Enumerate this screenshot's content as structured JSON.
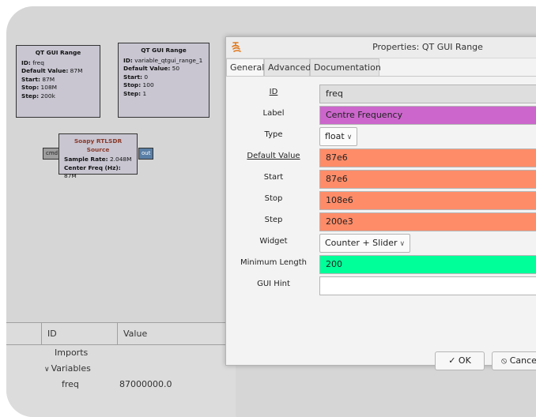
{
  "flowgraph": {
    "blocks": [
      {
        "title": "QT GUI Range",
        "lines": [
          {
            "key": "ID:",
            "value": " freq"
          },
          {
            "key": "Default Value:",
            "value": " 87M"
          },
          {
            "key": "Start:",
            "value": " 87M"
          },
          {
            "key": "Stop:",
            "value": " 108M"
          },
          {
            "key": "Step:",
            "value": " 200k"
          }
        ]
      },
      {
        "title": "QT GUI Range",
        "lines": [
          {
            "key": "ID:",
            "value": " variable_qtgui_range_1"
          },
          {
            "key": "Default Value:",
            "value": " 50"
          },
          {
            "key": "Start:",
            "value": " 0"
          },
          {
            "key": "Stop:",
            "value": " 100"
          },
          {
            "key": "Step:",
            "value": " 1"
          }
        ]
      },
      {
        "title": "Soapy RTLSDR Source",
        "lines": [
          {
            "key": "Sample Rate:",
            "value": " 2.048M"
          },
          {
            "key": "Center Freq (Hz):",
            "value": " 87M"
          }
        ],
        "port_in": "cmd",
        "port_out": "out"
      }
    ]
  },
  "variables_panel": {
    "col_id": "ID",
    "col_value": "Value",
    "rows": [
      "Imports",
      "Variables",
      "freq"
    ],
    "row_value": "87000000.0",
    "expand_glyph": "∨"
  },
  "dialog": {
    "title": "Properties: QT GUI Range",
    "tabs": [
      "General",
      "Advanced",
      "Documentation"
    ],
    "active_tab": "General",
    "properties": [
      {
        "label": "ID",
        "value": "freq",
        "kind": "text",
        "bg": "#dedede"
      },
      {
        "label": "Label",
        "value": "Centre Frequency",
        "kind": "text",
        "bg": "#cc66cc"
      },
      {
        "label": "Type",
        "value": "float",
        "kind": "combo"
      },
      {
        "label": "Default Value",
        "value": "87e6",
        "kind": "text",
        "bg": "#ff8c69"
      },
      {
        "label": "Start",
        "value": "87e6",
        "kind": "text",
        "bg": "#ff8c69"
      },
      {
        "label": "Stop",
        "value": "108e6",
        "kind": "text",
        "bg": "#ff8c69"
      },
      {
        "label": "Step",
        "value": "200e3",
        "kind": "text",
        "bg": "#ff8c69"
      },
      {
        "label": "Widget",
        "value": "Counter + Slider",
        "kind": "combo"
      },
      {
        "label": "Minimum Length",
        "value": "200",
        "kind": "text",
        "bg": "#00ff99"
      },
      {
        "label": "GUI Hint",
        "value": "",
        "kind": "text",
        "bg": "#ffffff"
      }
    ],
    "ok_label": "OK",
    "ok_icon": "✓",
    "cancel_label": "Cancel",
    "cancel_icon": "⦸",
    "chevron": "∨"
  }
}
